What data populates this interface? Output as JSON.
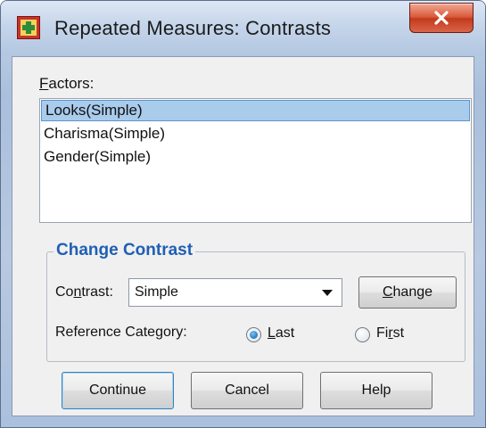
{
  "window": {
    "title": "Repeated Measures: Contrasts",
    "icon": "spss-dialog-icon",
    "close_icon": "close-icon"
  },
  "factors": {
    "label_accel": "F",
    "label_rest": "actors:",
    "items": [
      {
        "label": "Looks(Simple)",
        "selected": true
      },
      {
        "label": "Charisma(Simple)",
        "selected": false
      },
      {
        "label": "Gender(Simple)",
        "selected": false
      }
    ]
  },
  "change_contrast": {
    "group_title": "Change Contrast",
    "contrast_label_pre": "Co",
    "contrast_label_accel": "n",
    "contrast_label_post": "trast:",
    "contrast_value": "Simple",
    "change_button_accel": "C",
    "change_button_rest": "hange",
    "reference_category_label": "Reference Category:",
    "reference_options": [
      {
        "accel": "L",
        "rest": "ast",
        "selected": true
      },
      {
        "pre": "Fi",
        "accel": "r",
        "rest": "st",
        "selected": false
      }
    ]
  },
  "buttons": {
    "continue": "Continue",
    "cancel": "Cancel",
    "help": "Help"
  },
  "colors": {
    "group_title": "#1f5fb4",
    "selection": "#a9cbec",
    "close_button": "#c23a1c"
  }
}
